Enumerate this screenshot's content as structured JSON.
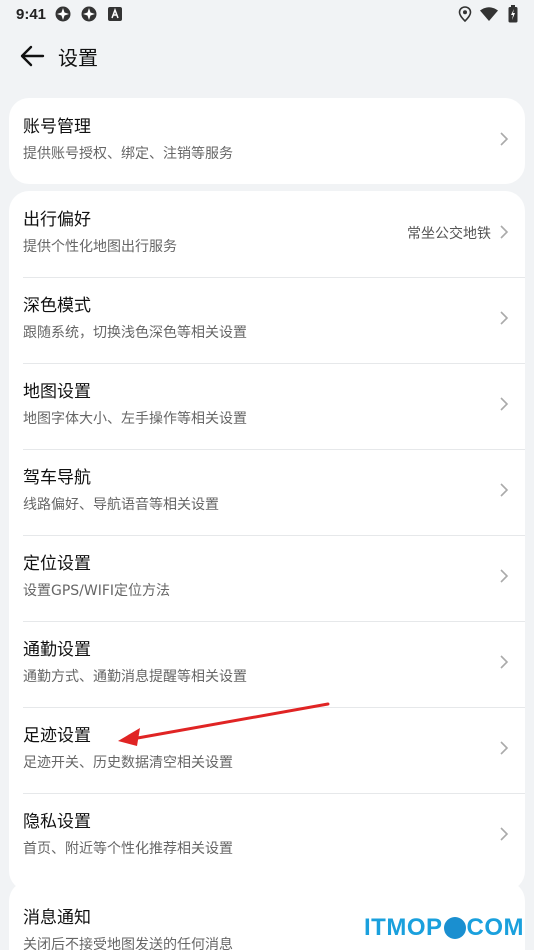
{
  "status": {
    "time": "9:41",
    "icons": [
      "vpn-flower-icon",
      "vpn-flower-icon",
      "a-notification-icon",
      "location-icon",
      "wifi-icon",
      "battery-charging-icon"
    ]
  },
  "header": {
    "title": "设置",
    "back_icon": "arrow-left-icon"
  },
  "account": {
    "title": "账号管理",
    "subtitle": "提供账号授权、绑定、注销等服务"
  },
  "settings": [
    {
      "key": "travel",
      "title": "出行偏好",
      "subtitle": "提供个性化地图出行服务",
      "value": "常坐公交地铁"
    },
    {
      "key": "dark",
      "title": "深色模式",
      "subtitle": "跟随系统，切换浅色深色等相关设置"
    },
    {
      "key": "map",
      "title": "地图设置",
      "subtitle": "地图字体大小、左手操作等相关设置"
    },
    {
      "key": "drive",
      "title": "驾车导航",
      "subtitle": "线路偏好、导航语音等相关设置"
    },
    {
      "key": "location",
      "title": "定位设置",
      "subtitle": "设置GPS/WIFI定位方法"
    },
    {
      "key": "commute",
      "title": "通勤设置",
      "subtitle": "通勤方式、通勤消息提醒等相关设置"
    },
    {
      "key": "footprint",
      "title": "足迹设置",
      "subtitle": "足迹开关、历史数据清空相关设置"
    },
    {
      "key": "privacy",
      "title": "隐私设置",
      "subtitle": "首页、附近等个性化推荐相关设置"
    }
  ],
  "notify": {
    "title": "消息通知",
    "subtitle": "关闭后不接受地图发送的任何消息"
  },
  "annotation": {
    "color": "#e02424"
  },
  "watermark": {
    "left": "ITMOP",
    "right": "COM"
  }
}
